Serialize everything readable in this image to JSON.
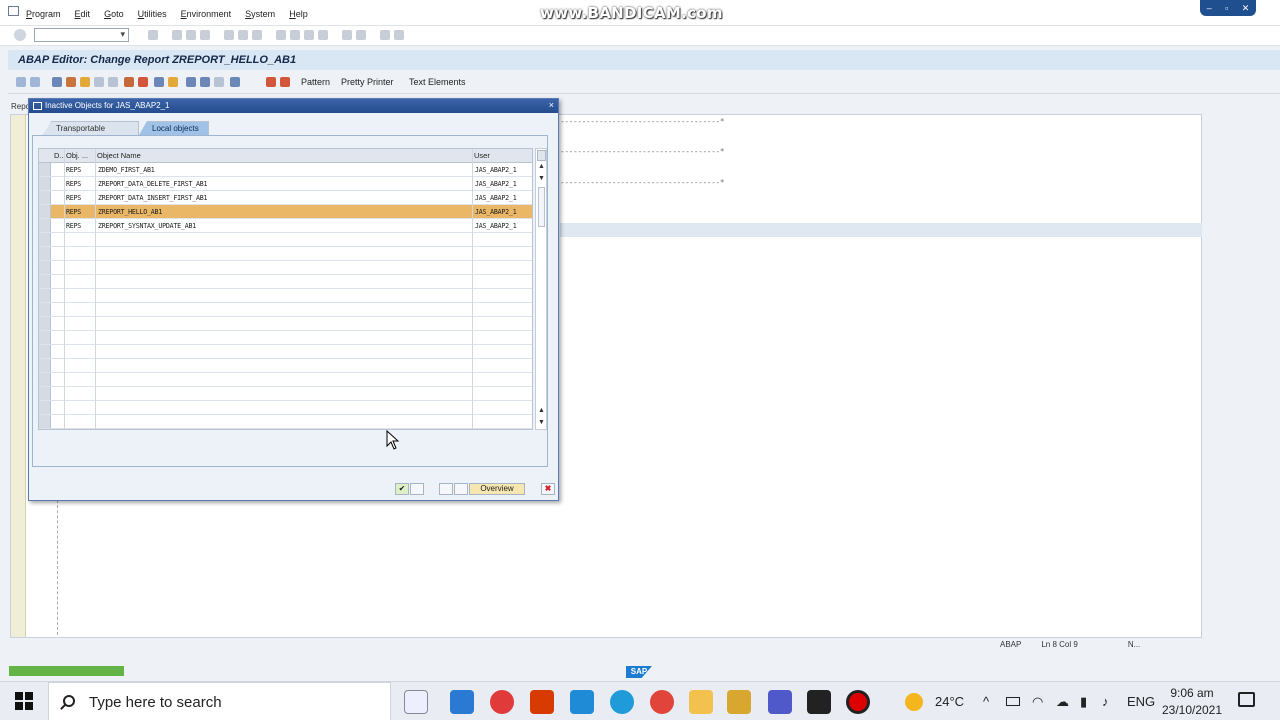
{
  "menu": [
    "Program",
    "Edit",
    "Goto",
    "Utilities",
    "Environment",
    "System",
    "Help"
  ],
  "watermark": "www.BANDICAM.com",
  "window_controls": [
    "–",
    "▫",
    "✕"
  ],
  "title": "ABAP Editor: Change Report ZREPORT_HELLO_AB1",
  "app_toolbar": {
    "pattern": "Pattern",
    "pretty_printer": "Pretty Printer",
    "text_elements": "Text Elements"
  },
  "editor": {
    "left_label": "Repo",
    "comment_lines": [
      "-------------------------------------*",
      "-------------------------------------*",
      "-------------------------------------*"
    ]
  },
  "status": {
    "lang": "ABAP",
    "position": "Ln   8 Col  9",
    "mode": "N..."
  },
  "sap_logo": "SAP",
  "dialog": {
    "title": "Inactive Objects for JAS_ABAP2_1",
    "close": "×",
    "tabs": [
      "Transportable Objects",
      "Local objects"
    ],
    "active_tab": 1,
    "columns": {
      "d": "D..",
      "obj": "Obj. ...",
      "name": "Object Name",
      "user": "User"
    },
    "rows": [
      {
        "obj": "REPS",
        "name": "ZDEMO_FIRST_AB1",
        "user": "JAS_ABAP2_1"
      },
      {
        "obj": "REPS",
        "name": "ZREPORT_DATA_DELETE_FIRST_AB1",
        "user": "JAS_ABAP2_1"
      },
      {
        "obj": "REPS",
        "name": "ZREPORT_DATA_INSERT_FIRST_AB1",
        "user": "JAS_ABAP2_1"
      },
      {
        "obj": "REPS",
        "name": "ZREPORT_HELLO_AB1",
        "user": "JAS_ABAP2_1"
      },
      {
        "obj": "REPS",
        "name": "ZREPORT_SYSNTAX_UPDATE_AB1",
        "user": "JAS_ABAP2_1"
      }
    ],
    "selected_row": 3,
    "overview_button": "Overview"
  },
  "taskbar": {
    "search_placeholder": "Type here to search",
    "temperature": "24°C",
    "language": "ENG",
    "time": "9:06 am",
    "date": "23/10/2021"
  },
  "colors": {
    "selected_row": "#e9b766",
    "title_bg": "#d9e6f3",
    "dialog_title": "#244c8f",
    "progress": "#63b346"
  }
}
